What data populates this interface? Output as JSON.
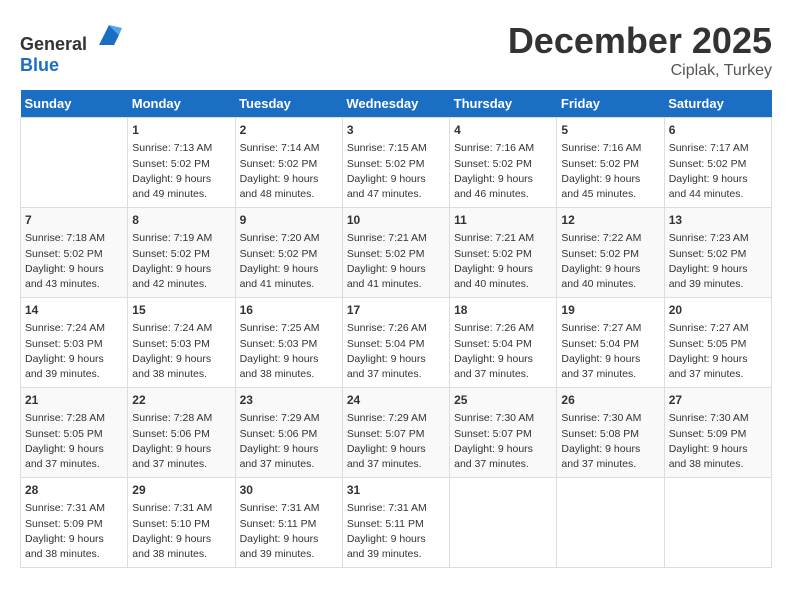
{
  "header": {
    "logo_general": "General",
    "logo_blue": "Blue",
    "month": "December 2025",
    "location": "Ciplak, Turkey"
  },
  "days_of_week": [
    "Sunday",
    "Monday",
    "Tuesday",
    "Wednesday",
    "Thursday",
    "Friday",
    "Saturday"
  ],
  "weeks": [
    [
      {
        "day": "",
        "info": ""
      },
      {
        "day": "1",
        "info": "Sunrise: 7:13 AM\nSunset: 5:02 PM\nDaylight: 9 hours\nand 49 minutes."
      },
      {
        "day": "2",
        "info": "Sunrise: 7:14 AM\nSunset: 5:02 PM\nDaylight: 9 hours\nand 48 minutes."
      },
      {
        "day": "3",
        "info": "Sunrise: 7:15 AM\nSunset: 5:02 PM\nDaylight: 9 hours\nand 47 minutes."
      },
      {
        "day": "4",
        "info": "Sunrise: 7:16 AM\nSunset: 5:02 PM\nDaylight: 9 hours\nand 46 minutes."
      },
      {
        "day": "5",
        "info": "Sunrise: 7:16 AM\nSunset: 5:02 PM\nDaylight: 9 hours\nand 45 minutes."
      },
      {
        "day": "6",
        "info": "Sunrise: 7:17 AM\nSunset: 5:02 PM\nDaylight: 9 hours\nand 44 minutes."
      }
    ],
    [
      {
        "day": "7",
        "info": "Sunrise: 7:18 AM\nSunset: 5:02 PM\nDaylight: 9 hours\nand 43 minutes."
      },
      {
        "day": "8",
        "info": "Sunrise: 7:19 AM\nSunset: 5:02 PM\nDaylight: 9 hours\nand 42 minutes."
      },
      {
        "day": "9",
        "info": "Sunrise: 7:20 AM\nSunset: 5:02 PM\nDaylight: 9 hours\nand 41 minutes."
      },
      {
        "day": "10",
        "info": "Sunrise: 7:21 AM\nSunset: 5:02 PM\nDaylight: 9 hours\nand 41 minutes."
      },
      {
        "day": "11",
        "info": "Sunrise: 7:21 AM\nSunset: 5:02 PM\nDaylight: 9 hours\nand 40 minutes."
      },
      {
        "day": "12",
        "info": "Sunrise: 7:22 AM\nSunset: 5:02 PM\nDaylight: 9 hours\nand 40 minutes."
      },
      {
        "day": "13",
        "info": "Sunrise: 7:23 AM\nSunset: 5:02 PM\nDaylight: 9 hours\nand 39 minutes."
      }
    ],
    [
      {
        "day": "14",
        "info": "Sunrise: 7:24 AM\nSunset: 5:03 PM\nDaylight: 9 hours\nand 39 minutes."
      },
      {
        "day": "15",
        "info": "Sunrise: 7:24 AM\nSunset: 5:03 PM\nDaylight: 9 hours\nand 38 minutes."
      },
      {
        "day": "16",
        "info": "Sunrise: 7:25 AM\nSunset: 5:03 PM\nDaylight: 9 hours\nand 38 minutes."
      },
      {
        "day": "17",
        "info": "Sunrise: 7:26 AM\nSunset: 5:04 PM\nDaylight: 9 hours\nand 37 minutes."
      },
      {
        "day": "18",
        "info": "Sunrise: 7:26 AM\nSunset: 5:04 PM\nDaylight: 9 hours\nand 37 minutes."
      },
      {
        "day": "19",
        "info": "Sunrise: 7:27 AM\nSunset: 5:04 PM\nDaylight: 9 hours\nand 37 minutes."
      },
      {
        "day": "20",
        "info": "Sunrise: 7:27 AM\nSunset: 5:05 PM\nDaylight: 9 hours\nand 37 minutes."
      }
    ],
    [
      {
        "day": "21",
        "info": "Sunrise: 7:28 AM\nSunset: 5:05 PM\nDaylight: 9 hours\nand 37 minutes."
      },
      {
        "day": "22",
        "info": "Sunrise: 7:28 AM\nSunset: 5:06 PM\nDaylight: 9 hours\nand 37 minutes."
      },
      {
        "day": "23",
        "info": "Sunrise: 7:29 AM\nSunset: 5:06 PM\nDaylight: 9 hours\nand 37 minutes."
      },
      {
        "day": "24",
        "info": "Sunrise: 7:29 AM\nSunset: 5:07 PM\nDaylight: 9 hours\nand 37 minutes."
      },
      {
        "day": "25",
        "info": "Sunrise: 7:30 AM\nSunset: 5:07 PM\nDaylight: 9 hours\nand 37 minutes."
      },
      {
        "day": "26",
        "info": "Sunrise: 7:30 AM\nSunset: 5:08 PM\nDaylight: 9 hours\nand 37 minutes."
      },
      {
        "day": "27",
        "info": "Sunrise: 7:30 AM\nSunset: 5:09 PM\nDaylight: 9 hours\nand 38 minutes."
      }
    ],
    [
      {
        "day": "28",
        "info": "Sunrise: 7:31 AM\nSunset: 5:09 PM\nDaylight: 9 hours\nand 38 minutes."
      },
      {
        "day": "29",
        "info": "Sunrise: 7:31 AM\nSunset: 5:10 PM\nDaylight: 9 hours\nand 38 minutes."
      },
      {
        "day": "30",
        "info": "Sunrise: 7:31 AM\nSunset: 5:11 PM\nDaylight: 9 hours\nand 39 minutes."
      },
      {
        "day": "31",
        "info": "Sunrise: 7:31 AM\nSunset: 5:11 PM\nDaylight: 9 hours\nand 39 minutes."
      },
      {
        "day": "",
        "info": ""
      },
      {
        "day": "",
        "info": ""
      },
      {
        "day": "",
        "info": ""
      }
    ]
  ]
}
